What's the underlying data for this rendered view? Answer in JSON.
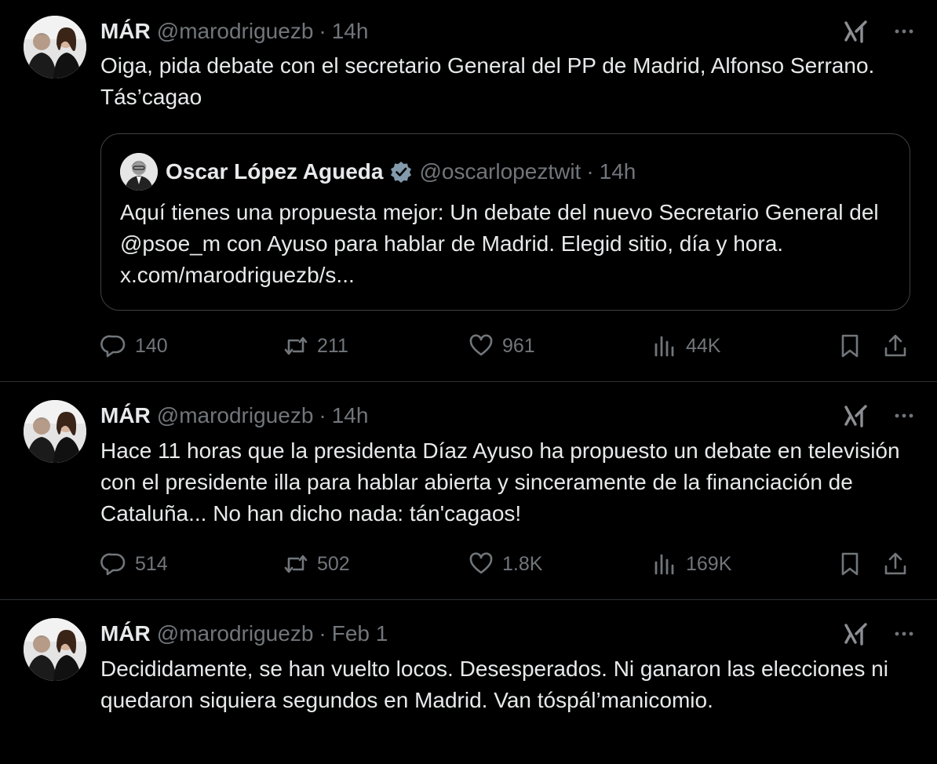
{
  "tweets": [
    {
      "display_name": "MÁR",
      "handle": "@marodriguezb",
      "separator": "·",
      "time": "14h",
      "text": "Oiga, pida debate con el secretario General del PP de Madrid, Alfonso Serrano. Tás’cagao",
      "quote": {
        "display_name": "Oscar López Agueda",
        "handle": "@oscarlopeztwit",
        "separator": "·",
        "time": "14h",
        "text": "Aquí tienes una propuesta mejor: Un debate del nuevo Secretario General del @psoe_m con Ayuso para hablar de Madrid. Elegid sitio, día y hora. x.com/marodriguezb/s..."
      },
      "stats": {
        "replies": "140",
        "reposts": "211",
        "likes": "961",
        "views": "44K"
      }
    },
    {
      "display_name": "MÁR",
      "handle": "@marodriguezb",
      "separator": "·",
      "time": "14h",
      "text": "Hace 11 horas que la presidenta Díaz Ayuso ha propuesto un debate en televisión con el presidente illa para hablar abierta y sinceramente de la financiación de Cataluña... No han dicho nada: tán'cagaos!",
      "stats": {
        "replies": "514",
        "reposts": "502",
        "likes": "1.8K",
        "views": "169K"
      }
    },
    {
      "display_name": "MÁR",
      "handle": "@marodriguezb",
      "separator": "·",
      "time": "Feb 1",
      "text": "Decididamente, se han vuelto locos. Desesperados. Ni ganaron las elecciones ni quedaron siquiera segundos en Madrid. Van tóspál’manicomio."
    }
  ],
  "icons": {
    "grok": "grok-icon",
    "more": "more-horizontal-icon",
    "reply": "reply-bubble-icon",
    "repost": "repost-arrows-icon",
    "like": "heart-icon",
    "views": "bar-chart-icon",
    "bookmark": "bookmark-icon",
    "share": "share-upload-icon",
    "verified": "verified-badge-icon"
  },
  "colors": {
    "background": "#000000",
    "text": "#e7e9ea",
    "secondary": "#71767b",
    "divider": "#2f3336",
    "verified": "#829aab"
  }
}
